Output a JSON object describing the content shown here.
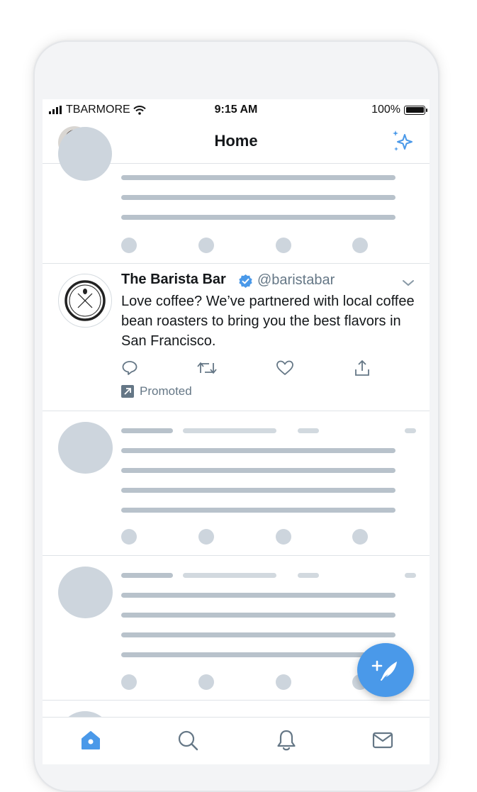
{
  "status_bar": {
    "carrier": "TBARMORE",
    "time": "9:15 AM",
    "battery": "100%"
  },
  "header": {
    "title": "Home"
  },
  "tweet": {
    "name": "The Barista Bar",
    "handle": "@baristabar",
    "text": "Love coffee? We’ve partnered with local coffee bean roasters to bring you the best flavors in San Francisco.",
    "promoted_label": "Promoted"
  },
  "colors": {
    "accent": "#4a99e9",
    "skeleton": "#cdd5dd",
    "text": "#14171a",
    "muted": "#657786"
  },
  "icons": [
    "signal-icon",
    "wifi-icon",
    "battery-icon",
    "sparkle-icon",
    "verified-icon",
    "chevron-down-icon",
    "reply-icon",
    "retweet-icon",
    "like-icon",
    "share-icon",
    "promoted-icon",
    "compose-icon",
    "home-icon",
    "search-icon",
    "notifications-icon",
    "messages-icon"
  ]
}
